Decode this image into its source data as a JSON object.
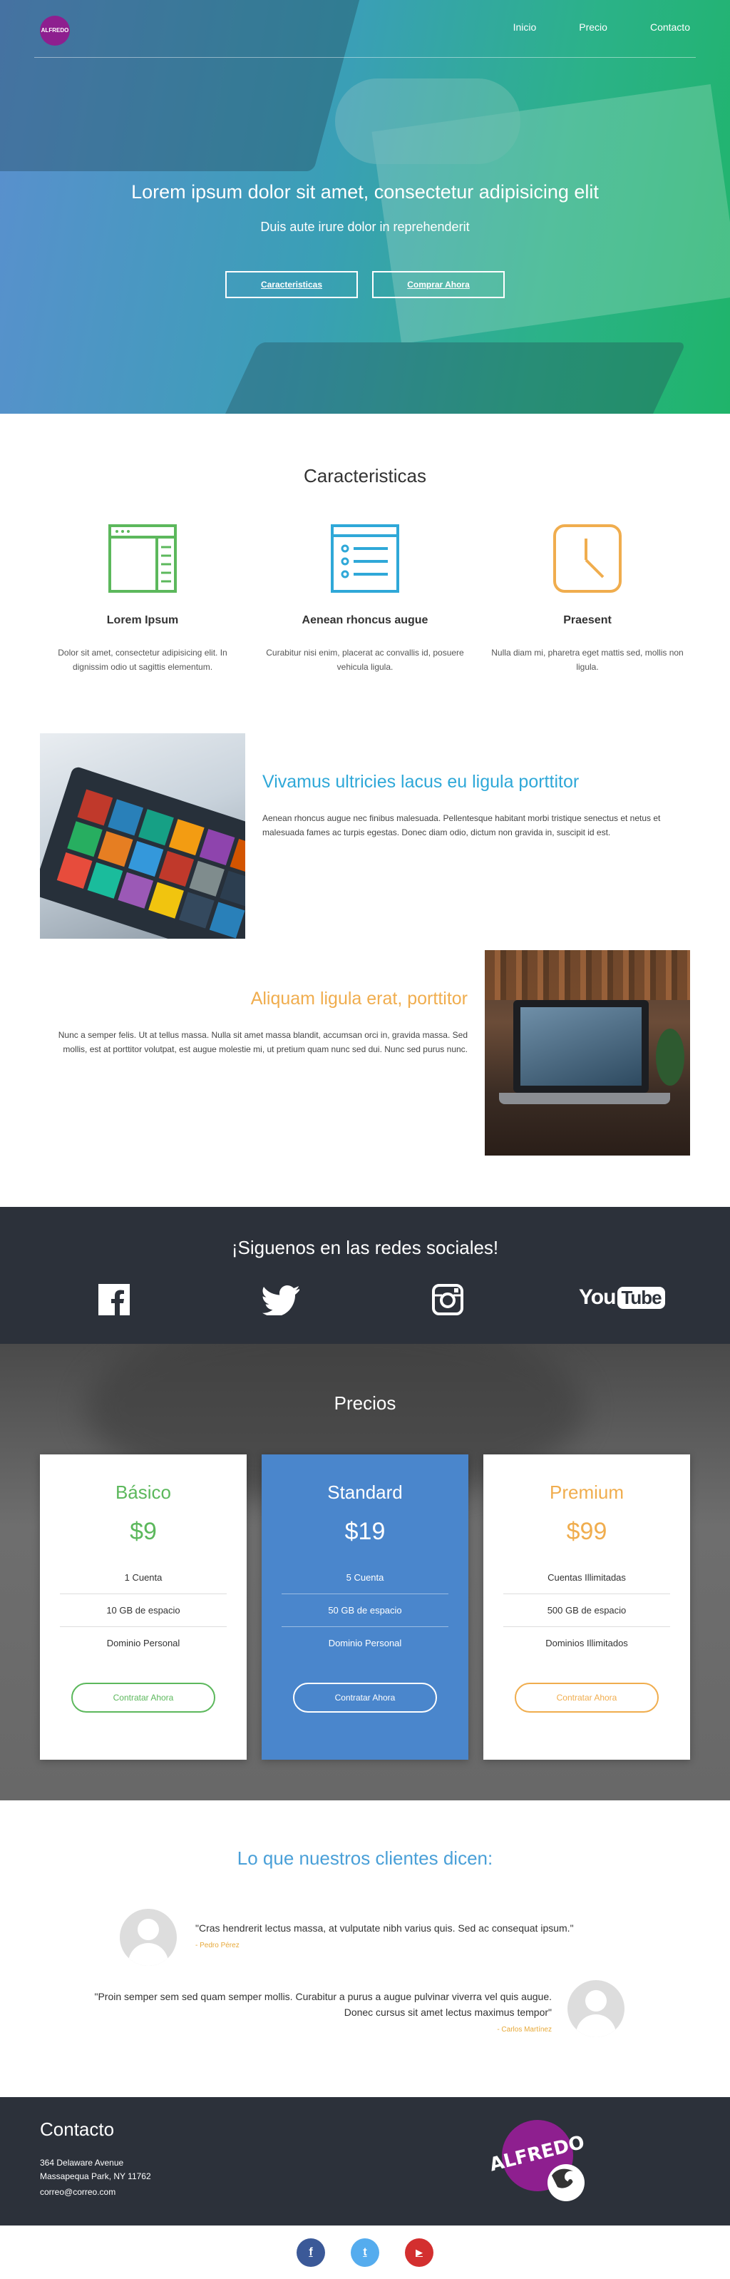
{
  "nav": {
    "logo_text": "ALFREDO",
    "links": [
      "Inicio",
      "Precio",
      "Contacto"
    ]
  },
  "hero": {
    "title": "Lorem ipsum dolor sit amet, consectetur adipisicing elit",
    "subtitle": "Duis aute irure dolor in reprehenderit",
    "btn_features": "Caracteristicas",
    "btn_buy": "Comprar Ahora"
  },
  "features": {
    "title": "Caracteristicas",
    "items": [
      {
        "icon": "browser-window-icon",
        "color": "#5cb85c",
        "title": "Lorem Ipsum",
        "text": "Dolor sit amet, consectetur adipisicing elit. In dignissim odio ut sagittis elementum."
      },
      {
        "icon": "list-icon",
        "color": "#2fa8d8",
        "title": "Aenean rhoncus augue",
        "text": "Curabitur nisi enim, placerat ac convallis id, posuere vehicula ligula."
      },
      {
        "icon": "clock-icon",
        "color": "#f0ad4e",
        "title": "Praesent",
        "text": "Nulla diam mi, pharetra eget mattis sed, mollis non ligula."
      }
    ]
  },
  "split1": {
    "title": "Vivamus ultricies lacus eu ligula porttitor",
    "text": "Aenean rhoncus augue nec finibus malesuada. Pellentesque habitant morbi tristique senectus et netus et malesuada fames ac turpis egestas. Donec diam odio, dictum non gravida in, suscipit id est.",
    "color": "#2fa8d8"
  },
  "split2": {
    "title": "Aliquam ligula erat, porttitor",
    "text": "Nunc a semper felis. Ut at tellus massa. Nulla sit amet massa blandit, accumsan orci in, gravida massa. Sed mollis, est at porttitor volutpat, est augue molestie mi, ut pretium quam nunc sed dui. Nunc sed purus nunc.",
    "color": "#f0ad4e"
  },
  "social": {
    "title": "¡Siguenos en las redes sociales!",
    "networks": [
      "facebook",
      "twitter",
      "instagram",
      "youtube"
    ],
    "youtube_you": "You",
    "youtube_tube": "Tube"
  },
  "pricing": {
    "title": "Precios",
    "plans": [
      {
        "name": "Básico",
        "price": "$9",
        "features": [
          "1 Cuenta",
          "10 GB de espacio",
          "Dominio Personal"
        ],
        "cta": "Contratar Ahora",
        "color": "#5cb85c"
      },
      {
        "name": "Standard",
        "price": "$19",
        "features": [
          "5 Cuenta",
          "50 GB de espacio",
          "Dominio Personal"
        ],
        "cta": "Contratar Ahora",
        "color": "#4a86cc"
      },
      {
        "name": "Premium",
        "price": "$99",
        "features": [
          "Cuentas Illimitadas",
          "500 GB de espacio",
          "Dominios Illimitados"
        ],
        "cta": "Contratar Ahora",
        "color": "#f0ad4e"
      }
    ]
  },
  "testimonials": {
    "title": "Lo que nuestros clientes dicen:",
    "items": [
      {
        "quote": "\"Cras hendrerit lectus massa, at vulputate nibh varius quis. Sed ac consequat ipsum.\"",
        "author": "- Pedro Pérez"
      },
      {
        "quote": "\"Proin semper sem sed quam semper mollis. Curabitur a purus a augue pulvinar viverra vel quis augue. Donec cursus sit amet lectus maximus tempor\"",
        "author": "- Carlos Martínez"
      }
    ]
  },
  "contact": {
    "title": "Contacto",
    "address1": "364 Delaware Avenue",
    "address2": "Massapequa Park, NY 11762",
    "email": "correo@correo.com",
    "logo_text": "ALFREDO"
  },
  "footer": {
    "buttons": [
      {
        "icon": "facebook-icon",
        "glyph": "f",
        "color": "#3b5998"
      },
      {
        "icon": "twitter-icon",
        "glyph": "t",
        "color": "#55acee"
      },
      {
        "icon": "youtube-icon",
        "glyph": "▶",
        "color": "#d32f2f"
      }
    ]
  }
}
